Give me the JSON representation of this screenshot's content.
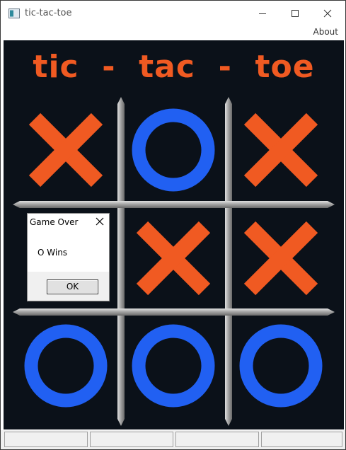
{
  "window": {
    "title": "tic-tac-toe",
    "menu": {
      "about_label": "About"
    }
  },
  "game": {
    "title": "tic  -  tac  -  toe",
    "board": [
      [
        "X",
        "O",
        "X"
      ],
      [
        "",
        "X",
        "X"
      ],
      [
        "O",
        "O",
        "O"
      ]
    ],
    "colors": {
      "background": "#0b1119",
      "x": "#f05a22",
      "o": "#2160f2",
      "grid": "#a8a8a8"
    }
  },
  "dialog": {
    "title": "Game Over",
    "message": "O Wins",
    "ok_label": "OK"
  },
  "icons": {
    "app": "window-app-icon",
    "minimize": "minimize-icon",
    "maximize": "maximize-icon",
    "close": "close-icon",
    "dialog_close": "close-icon"
  }
}
